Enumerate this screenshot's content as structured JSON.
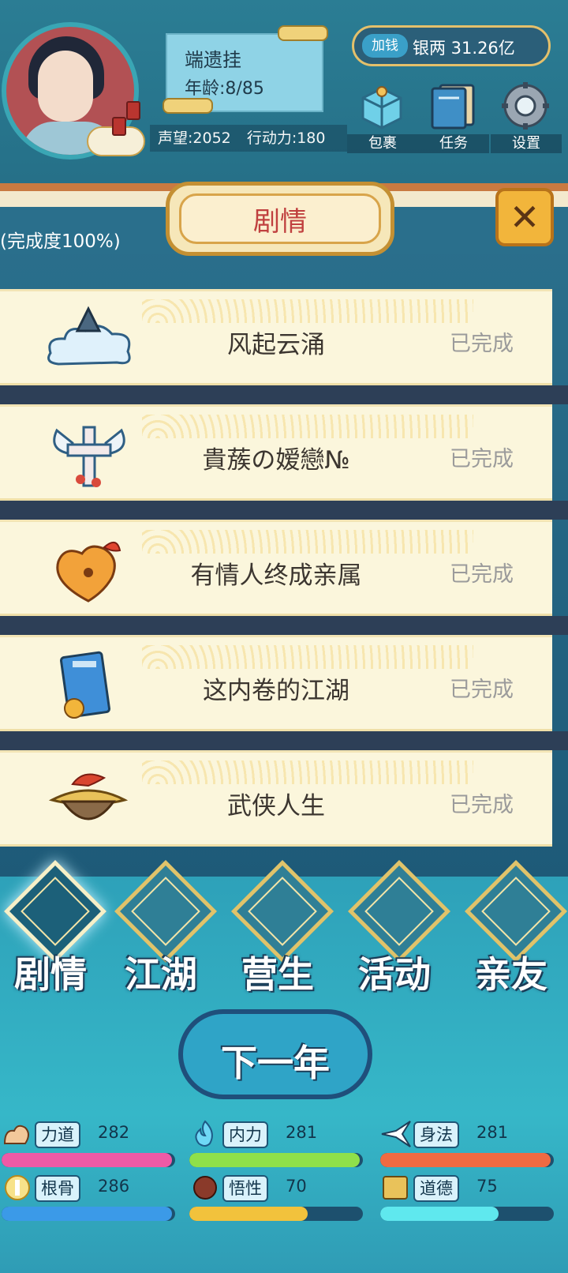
{
  "profile": {
    "name": "端遗挂",
    "age": "年龄:8/85",
    "reputation": "声望:2052",
    "action_points": "行动力:180"
  },
  "money": {
    "add_label": "加钱",
    "amount": "银两 31.26亿"
  },
  "top_buttons": [
    {
      "label": "包裹",
      "icon": "bag-icon"
    },
    {
      "label": "任务",
      "icon": "task-book-icon"
    },
    {
      "label": "设置",
      "icon": "gear-icon"
    }
  ],
  "panel": {
    "title": "剧情",
    "completion": "(完成度100%)",
    "close_icon": "close-icon"
  },
  "stories": [
    {
      "title": "风起云涌",
      "status": "已完成",
      "icon": "cloud-hat-icon"
    },
    {
      "title": "貴蔟の嫒戀№",
      "status": "已完成",
      "icon": "winged-cross-icon"
    },
    {
      "title": "有情人终成亲属",
      "status": "已完成",
      "icon": "heart-lock-icon"
    },
    {
      "title": "这内卷的江湖",
      "status": "已完成",
      "icon": "blue-book-icon"
    },
    {
      "title": "武侠人生",
      "status": "已完成",
      "icon": "straw-hat-hero-icon"
    }
  ],
  "nav": [
    {
      "label": "剧情",
      "icon": "brush-icon",
      "active": true
    },
    {
      "label": "江湖",
      "icon": "scholar-hat-icon",
      "active": false
    },
    {
      "label": "营生",
      "icon": "abacus-icon",
      "active": false
    },
    {
      "label": "活动",
      "icon": "scroll-icon",
      "active": false
    },
    {
      "label": "亲友",
      "icon": "couple-icon",
      "active": false
    }
  ],
  "next_year": "下一年",
  "attributes": [
    {
      "name": "力道",
      "value": "282",
      "icon": "muscle-arm-icon",
      "fill": 0.98,
      "color": "#ee5aa6"
    },
    {
      "name": "内力",
      "value": "281",
      "icon": "flame-icon",
      "fill": 0.98,
      "color": "#8fe04a"
    },
    {
      "name": "身法",
      "value": "281",
      "icon": "swallow-icon",
      "fill": 0.98,
      "color": "#f06a42"
    },
    {
      "name": "根骨",
      "value": "286",
      "icon": "skeleton-aura-icon",
      "fill": 0.98,
      "color": "#3b9ae8"
    },
    {
      "name": "悟性",
      "value": "70",
      "icon": "head-icon",
      "fill": 0.68,
      "color": "#f2c23c"
    },
    {
      "name": "道德",
      "value": "75",
      "icon": "book-icon",
      "fill": 0.68,
      "color": "#5fe8ee"
    }
  ]
}
